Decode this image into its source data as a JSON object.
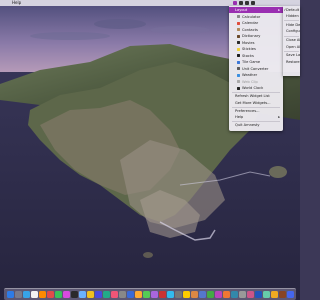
{
  "menubar": {
    "apple_glyph": "",
    "help_label": "Help"
  },
  "menu": {
    "items": [
      {
        "label": "Layout",
        "arrow": "▸",
        "highlighted": true
      },
      {
        "label": "Calculator",
        "icon_color": "#8a8a8a"
      },
      {
        "label": "Calendar",
        "icon_color": "#e04b3a"
      },
      {
        "label": "Contacts",
        "icon_color": "#b08a5a"
      },
      {
        "label": "Dictionary",
        "icon_color": "#6b4a2a"
      },
      {
        "label": "Movies",
        "icon_color": "#2a2a2a"
      },
      {
        "label": "Stickies",
        "icon_color": "#f0d23a"
      },
      {
        "label": "Stocks",
        "icon_color": "#1e1e1e"
      },
      {
        "label": "Tile Game",
        "icon_color": "#3b78d8"
      },
      {
        "label": "Unit Converter",
        "icon_color": "#5a5a5a"
      },
      {
        "label": "Weather",
        "icon_color": "#3a8fe0"
      },
      {
        "label": "Web Clip",
        "icon_color": "#aaaaaa",
        "disabled": true
      },
      {
        "label": "World Clock",
        "icon_color": "#222222"
      },
      {
        "label": "Refresh Widget List"
      },
      {
        "label": "Get More Widgets..."
      },
      {
        "label": "Preferences..."
      },
      {
        "label": "Help",
        "arrow": "▸"
      },
      {
        "label": "Quit Amnesty"
      }
    ]
  },
  "submenu": {
    "items": [
      {
        "label": "Default",
        "checked": true
      },
      {
        "label": "Hidden"
      },
      {
        "label": "Hide Des"
      },
      {
        "label": "Configure"
      },
      {
        "label": "Close Al"
      },
      {
        "label": "Open All"
      },
      {
        "label": "Save La"
      },
      {
        "label": "Restore"
      }
    ],
    "check_glyph": "✓"
  },
  "colors": {
    "highlight": "#9a2fb1",
    "dock_icons": [
      "#2e7be6",
      "#7a7a8a",
      "#36a3e8",
      "#f2f2f2",
      "#ff8a00",
      "#e24a4a",
      "#3ac05a",
      "#d94adf",
      "#2a2a2a",
      "#6bb2ff",
      "#f0c020",
      "#4a4ae0",
      "#22aa88",
      "#ee5577",
      "#888888",
      "#3a6ad8",
      "#ffaa33",
      "#55cc55",
      "#aa66dd",
      "#cc3333",
      "#33bbee",
      "#777777",
      "#ffcc00",
      "#dd8844",
      "#5577cc",
      "#44aa44",
      "#bb44bb",
      "#ee7733",
      "#3388aa",
      "#999999",
      "#cc5588",
      "#2255bb",
      "#66ccaa",
      "#eeaa22",
      "#884422",
      "#4466ee"
    ]
  }
}
